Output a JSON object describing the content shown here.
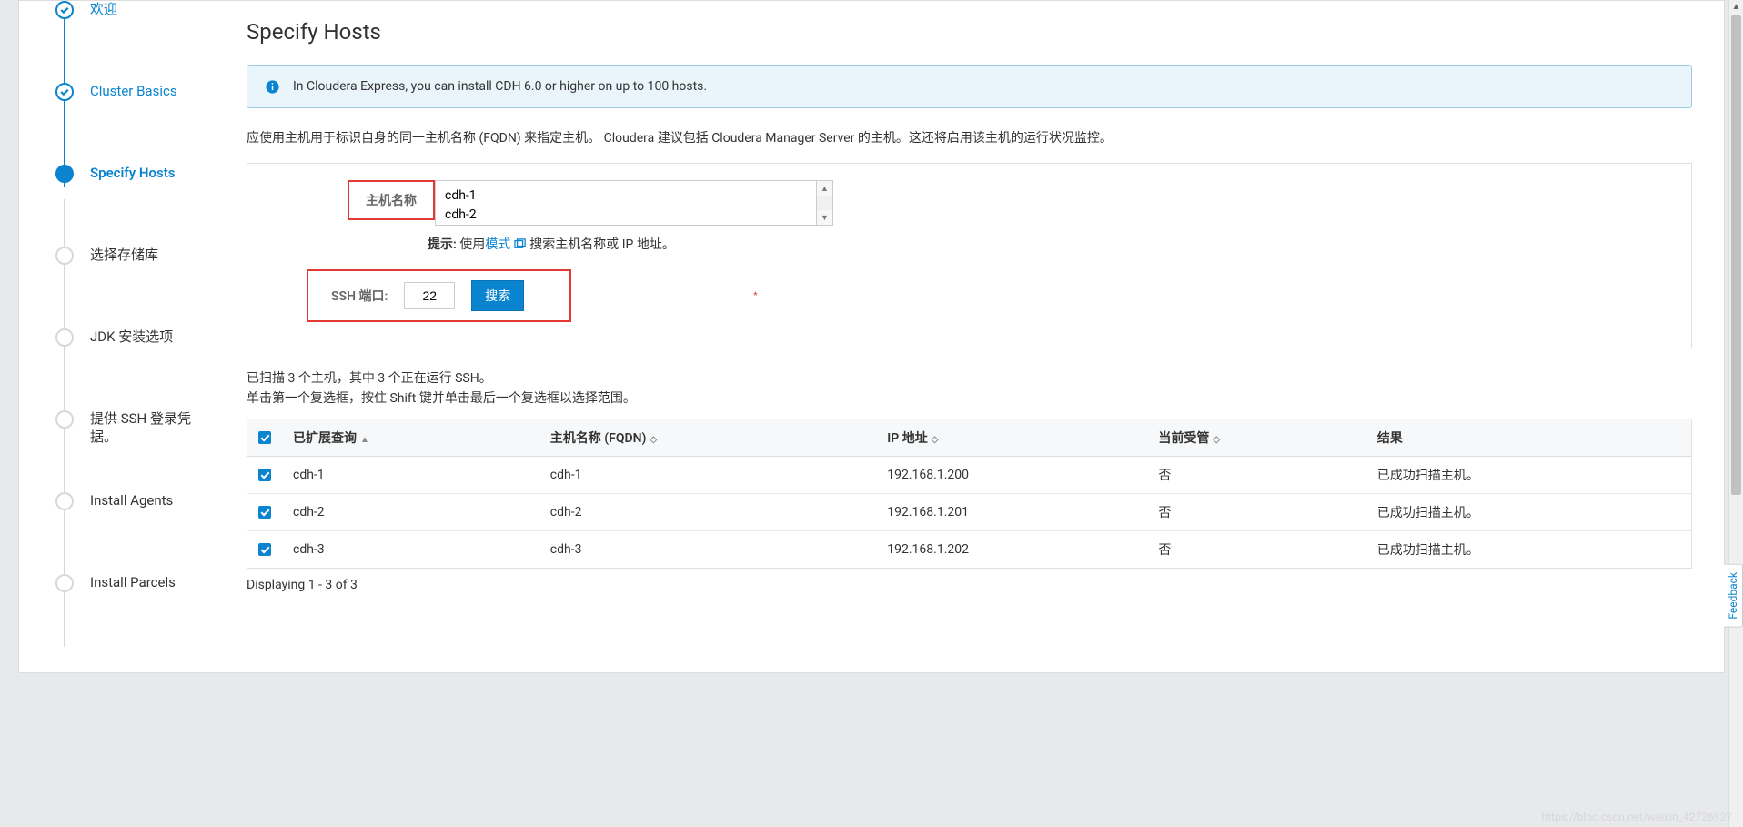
{
  "sidebar": {
    "steps": [
      {
        "label": "欢迎",
        "status": "done"
      },
      {
        "label": "Cluster Basics",
        "status": "done"
      },
      {
        "label": "Specify Hosts",
        "status": "active"
      },
      {
        "label": "选择存储库",
        "status": "pending"
      },
      {
        "label": "JDK 安装选项",
        "status": "pending"
      },
      {
        "label": "提供 SSH 登录凭据。",
        "status": "pending"
      },
      {
        "label": "Install Agents",
        "status": "pending"
      },
      {
        "label": "Install Parcels",
        "status": "pending"
      }
    ]
  },
  "main": {
    "title": "Specify Hosts",
    "info_banner": "In Cloudera Express, you can install CDH 6.0 or higher on up to 100 hosts.",
    "description": "应使用主机用于标识自身的同一主机名称 (FQDN) 来指定主机。 Cloudera 建议包括 Cloudera Manager Server 的主机。这还将启用该主机的运行状况监控。",
    "form": {
      "hostname_label": "主机名称",
      "hostname_value": "cdh-1\ncdh-2",
      "hint_label": "提示:",
      "hint_prefix": " 使用",
      "hint_link": "模式",
      "hint_suffix": "搜索主机名称或 IP 地址。",
      "ssh_label": "SSH 端口:",
      "ssh_port": "22",
      "search_btn": "搜索"
    },
    "scan_line1": "已扫描 3 个主机，其中 3 个正在运行 SSH。",
    "scan_line2": "单击第一个复选框，按住 Shift 键并单击最后一个复选框以选择范围。",
    "table": {
      "headers": {
        "expanded": "已扩展查询",
        "fqdn": "主机名称 (FQDN)",
        "ip": "IP 地址",
        "managed": "当前受管",
        "result": "结果"
      },
      "rows": [
        {
          "expanded": "cdh-1",
          "fqdn": "cdh-1",
          "ip": "192.168.1.200",
          "managed": "否",
          "result": "已成功扫描主机。"
        },
        {
          "expanded": "cdh-2",
          "fqdn": "cdh-2",
          "ip": "192.168.1.201",
          "managed": "否",
          "result": "已成功扫描主机。"
        },
        {
          "expanded": "cdh-3",
          "fqdn": "cdh-3",
          "ip": "192.168.1.202",
          "managed": "否",
          "result": "已成功扫描主机。"
        }
      ]
    },
    "display_count": "Displaying 1 - 3 of 3"
  },
  "feedback_label": "Feedback",
  "watermark": "https://blog.csdn.net/weixin_42726927"
}
